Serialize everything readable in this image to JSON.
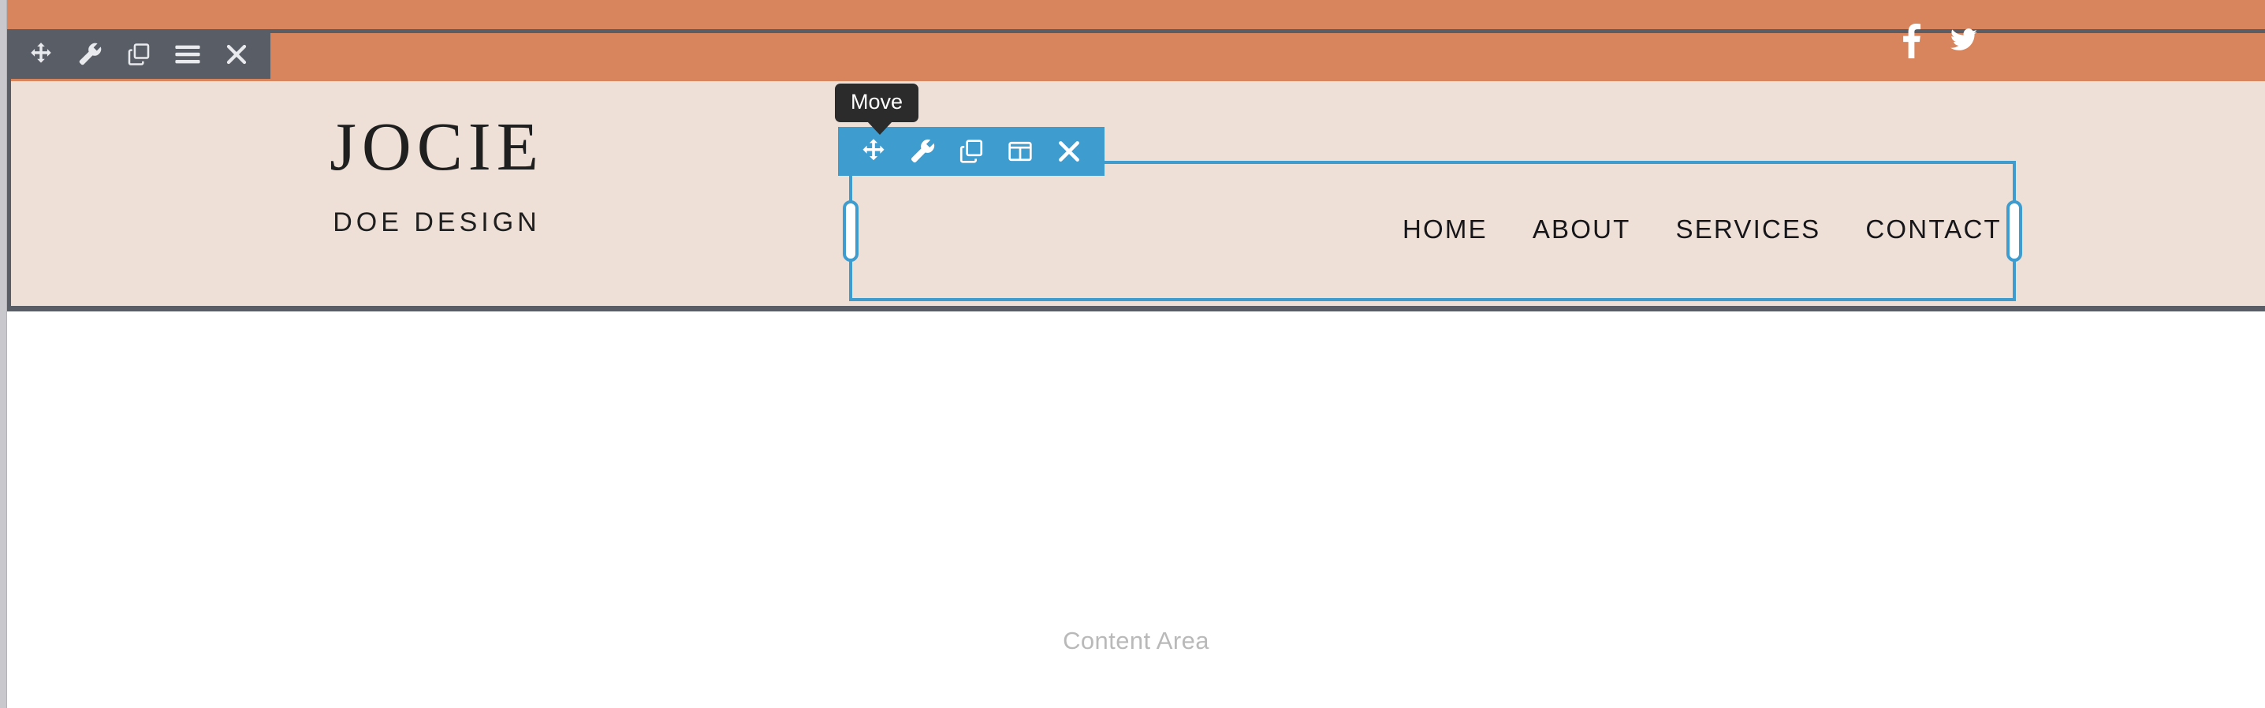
{
  "site": {
    "logo": {
      "name": "JOCIE",
      "tagline": "DOE DESIGN"
    },
    "nav": [
      {
        "label": "HOME"
      },
      {
        "label": "ABOUT"
      },
      {
        "label": "SERVICES"
      },
      {
        "label": "CONTACT"
      }
    ],
    "social": [
      {
        "name": "facebook-icon",
        "title": "Facebook"
      },
      {
        "name": "twitter-icon",
        "title": "Twitter"
      }
    ],
    "content_area": {
      "placeholder": "Content Area"
    }
  },
  "editor": {
    "tooltip": {
      "text": "Move"
    },
    "section_toolbar": {
      "color": "#585d66",
      "buttons": [
        {
          "name": "move-handle",
          "label": "Move"
        },
        {
          "name": "settings-wrench",
          "label": "Settings"
        },
        {
          "name": "duplicate",
          "label": "Duplicate"
        },
        {
          "name": "menu",
          "label": "Menu"
        },
        {
          "name": "delete",
          "label": "Delete"
        }
      ]
    },
    "module_toolbar": {
      "color": "#3f9cce",
      "buttons": [
        {
          "name": "move-handle",
          "label": "Move"
        },
        {
          "name": "settings-wrench",
          "label": "Settings"
        },
        {
          "name": "duplicate",
          "label": "Duplicate"
        },
        {
          "name": "columns",
          "label": "Columns"
        },
        {
          "name": "delete",
          "label": "Delete"
        }
      ]
    },
    "selection": {
      "outline_color": "#3f9cce",
      "handle_left_label": "Resize left",
      "handle_right_label": "Resize right"
    }
  },
  "theme": {
    "accent_orange": "#d8845c",
    "header_beige": "#eee0d7",
    "toolbar_dark": "#585d66",
    "toolbar_blue": "#3f9cce",
    "tooltip_bg": "#2b2b2b",
    "content_placeholder_gray": "#b9b9b9"
  }
}
